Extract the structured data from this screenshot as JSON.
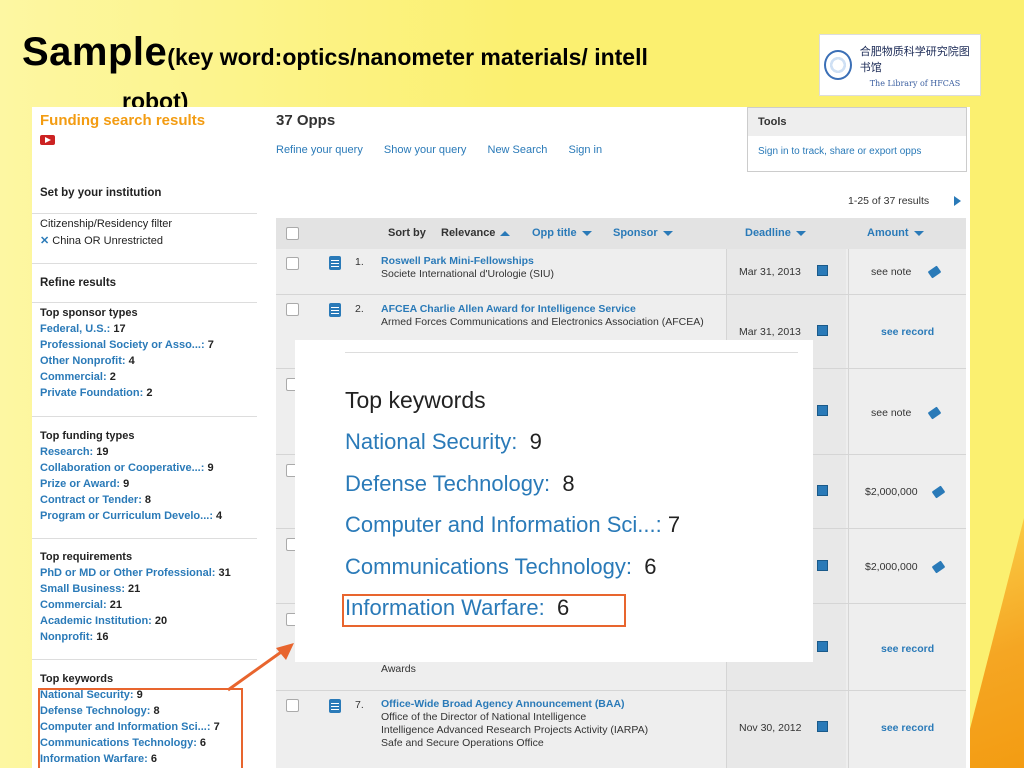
{
  "slide": {
    "title_big": "Sample",
    "title_small": "(key word:optics/nanometer materials/ intell",
    "title_line2": "robot)",
    "logo_cn": "合肥物质科学研究院图书馆",
    "logo_en": "The Library of HFCAS"
  },
  "sidebar": {
    "title": "Funding search results",
    "set_by": "Set by your institution",
    "citizenship_label": "Citizenship/Residency filter",
    "citizenship_value": "China OR Unrestricted",
    "refine_title": "Refine results",
    "sponsor_types": {
      "heading": "Top sponsor types",
      "items": [
        {
          "label": "Federal, U.S.:",
          "count": "17"
        },
        {
          "label": "Professional Society or Asso...:",
          "count": "7"
        },
        {
          "label": "Other Nonprofit:",
          "count": "4"
        },
        {
          "label": "Commercial:",
          "count": "2"
        },
        {
          "label": "Private Foundation:",
          "count": "2"
        }
      ]
    },
    "funding_types": {
      "heading": "Top funding types",
      "items": [
        {
          "label": "Research:",
          "count": "19"
        },
        {
          "label": "Collaboration or Cooperative...:",
          "count": "9"
        },
        {
          "label": "Prize or Award:",
          "count": "9"
        },
        {
          "label": "Contract or Tender:",
          "count": "8"
        },
        {
          "label": "Program or Curriculum Develo...:",
          "count": "4"
        }
      ]
    },
    "requirements": {
      "heading": "Top requirements",
      "items": [
        {
          "label": "PhD or MD or Other Professional:",
          "count": "31"
        },
        {
          "label": "Small Business:",
          "count": "21"
        },
        {
          "label": "Commercial:",
          "count": "21"
        },
        {
          "label": "Academic Institution:",
          "count": "20"
        },
        {
          "label": "Nonprofit:",
          "count": "16"
        }
      ]
    },
    "keywords": {
      "heading": "Top keywords",
      "items": [
        {
          "label": "National Security:",
          "count": "9"
        },
        {
          "label": "Defense Technology:",
          "count": "8"
        },
        {
          "label": "Computer and Information Sci...:",
          "count": "7"
        },
        {
          "label": "Communications Technology:",
          "count": "6"
        },
        {
          "label": "Information Warfare:",
          "count": "6"
        }
      ]
    }
  },
  "main": {
    "opps_count": "37 Opps",
    "links": [
      "Refine your query",
      "Show your query",
      "New Search",
      "Sign in"
    ],
    "tools_title": "Tools",
    "tools_link": "Sign in to track, share or export opps",
    "results_range": "1-25 of 37 results",
    "table_header": {
      "sort_by": "Sort by",
      "relevance": "Relevance",
      "opp_title": "Opp title",
      "sponsor": "Sponsor",
      "deadline": "Deadline",
      "amount": "Amount"
    },
    "rows": [
      {
        "num": "1.",
        "title": "Roswell Park Mini-Fellowships",
        "sub": "Societe International d'Urologie (SIU)",
        "deadline": "Mar 31, 2013",
        "amount": "see note"
      },
      {
        "num": "2.",
        "title": "AFCEA Charlie Allen Award for Intelligence Service",
        "sub": "Armed Forces Communications and Electronics Association (AFCEA)",
        "deadline": "Mar 31, 2013",
        "amount": "see record"
      },
      {
        "amount": "see note"
      },
      {
        "amount": "$2,000,000"
      },
      {
        "amount": "$2,000,000"
      },
      {
        "sub": "Awards",
        "amount": "see record"
      },
      {
        "num": "7.",
        "title": "Office-Wide Broad Agency Announcement (BAA)",
        "sub": "Office of the Director of National Intelligence\nIntelligence Advanced Research Projects Activity (IARPA)\nSafe and Secure Operations Office",
        "deadline": "Nov 30, 2012",
        "amount": "see record"
      }
    ]
  },
  "zoom": {
    "heading": "Top keywords",
    "items": [
      {
        "label": "National Security:",
        "count": "9"
      },
      {
        "label": "Defense Technology:",
        "count": "8"
      },
      {
        "label": "Computer and Information Sci...:",
        "count": "7"
      },
      {
        "label": "Communications Technology:",
        "count": "6"
      },
      {
        "label": "Information Warfare:",
        "count": "6"
      }
    ]
  },
  "colors": {
    "slide_bg": "#fbf070",
    "link_blue": "#2a7ab8",
    "title_orange": "#f39c12",
    "highlight": "#e8652e"
  }
}
